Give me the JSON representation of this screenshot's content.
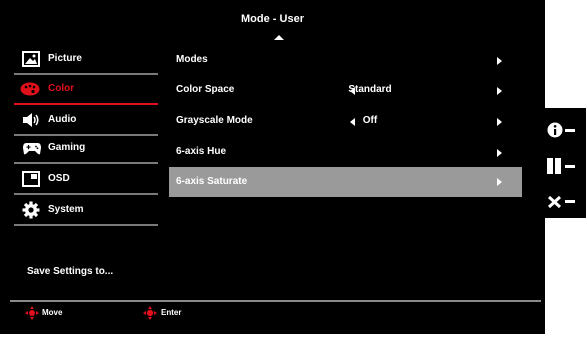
{
  "header": {
    "title": "Mode - User"
  },
  "sidebar": {
    "items": [
      {
        "label": "Picture",
        "icon": "picture-icon",
        "active": false
      },
      {
        "label": "Color",
        "icon": "color-palette-icon",
        "active": true
      },
      {
        "label": "Audio",
        "icon": "speaker-icon",
        "active": false
      },
      {
        "label": "Gaming",
        "icon": "gamepad-icon",
        "active": false
      },
      {
        "label": "OSD",
        "icon": "osd-window-icon",
        "active": false
      },
      {
        "label": "System",
        "icon": "gear-icon",
        "active": false
      }
    ],
    "save_label": "Save Settings to..."
  },
  "menu": {
    "rows": [
      {
        "label": "Modes",
        "value": "",
        "has_left_arrow": false,
        "selected": false
      },
      {
        "label": "Color Space",
        "value": "Standard",
        "has_left_arrow": true,
        "selected": false
      },
      {
        "label": "Grayscale Mode",
        "value": "Off",
        "has_left_arrow": true,
        "selected": false
      },
      {
        "label": "6-axis Hue",
        "value": "",
        "has_left_arrow": false,
        "selected": false
      },
      {
        "label": "6-axis Saturate",
        "value": "",
        "has_left_arrow": false,
        "selected": true
      }
    ]
  },
  "footer": {
    "move_label": "Move",
    "enter_label": "Enter"
  },
  "side_keys": [
    {
      "icon": "info-icon"
    },
    {
      "icon": "input-switch-icon"
    },
    {
      "icon": "close-icon"
    }
  ],
  "colors": {
    "accent": "#e0101a",
    "selection": "#9a9a9a",
    "background": "#000000",
    "text": "#ffffff"
  }
}
